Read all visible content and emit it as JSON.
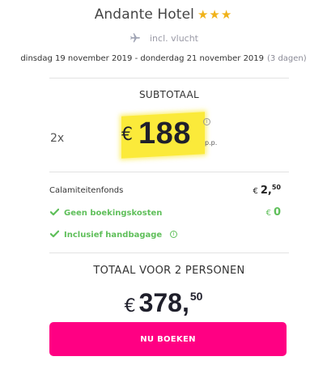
{
  "hotel": {
    "name": "Andante Hotel",
    "stars": "★★★"
  },
  "flight": {
    "label": "incl. vlucht",
    "icon": "plane-icon"
  },
  "dates": {
    "range": "dinsdag 19 november 2019  -  donderdag 21 november 2019",
    "duration": "(3 dagen)"
  },
  "subtotal": {
    "label": "SUBTOTAAL",
    "quantity": "2x",
    "currency": "€",
    "price": "188",
    "per_person": "p.p.",
    "info_icon": "i"
  },
  "fees": {
    "calamity": {
      "label": "Calamiteitenfonds",
      "currency": "€",
      "whole": "2,",
      "cents": "50"
    },
    "booking": {
      "label": "Geen boekingskosten",
      "currency": "€",
      "value": "0"
    },
    "baggage": {
      "label": "Inclusief handbagage",
      "info_icon": "i"
    }
  },
  "total": {
    "label": "TOTAAL VOOR 2 PERSONEN",
    "currency": "€",
    "whole": "378,",
    "cents": "50"
  },
  "cta": {
    "label": "NU BOEKEN"
  },
  "colors": {
    "accent": "#ff0083",
    "highlight": "#fbea3a",
    "success": "#5fbf5a",
    "star": "#f0b21a"
  }
}
